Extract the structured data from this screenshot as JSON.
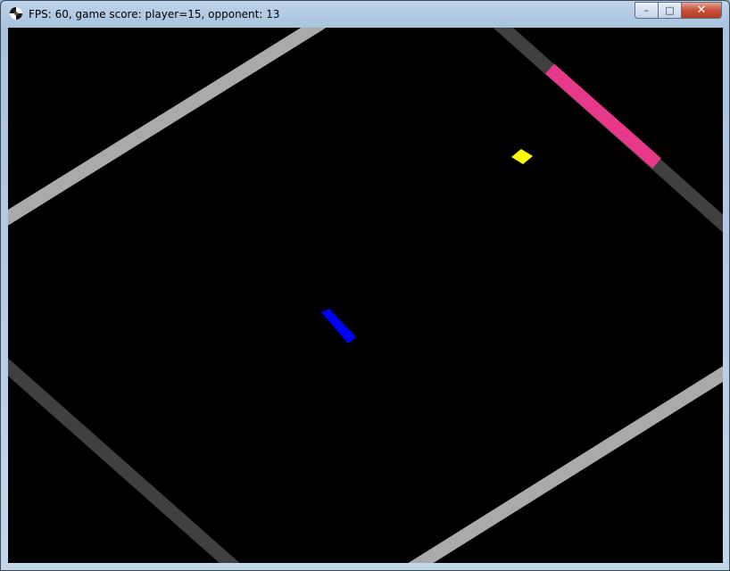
{
  "window": {
    "title": "FPS: 60, game score: player=15, opponent: 13",
    "app_icon": "game-app-icon",
    "buttons": {
      "minimize_icon": "minimize-icon",
      "maximize_icon": "maximize-icon",
      "close_icon": "close-icon"
    }
  },
  "game": {
    "background_color": "#000000",
    "walls": [
      {
        "name": "wall-top-left",
        "color": "#aaaaaa"
      },
      {
        "name": "wall-top-right",
        "color": "#404040"
      },
      {
        "name": "wall-bottom-left",
        "color": "#404040"
      },
      {
        "name": "wall-bottom-right",
        "color": "#aaaaaa"
      }
    ],
    "opponent_paddle": {
      "color": "#e8388a"
    },
    "player_paddle": {
      "color": "#0000ff"
    },
    "ball": {
      "color": "#ffff00"
    },
    "score": {
      "player": 15,
      "opponent": 13
    },
    "fps": 60
  }
}
